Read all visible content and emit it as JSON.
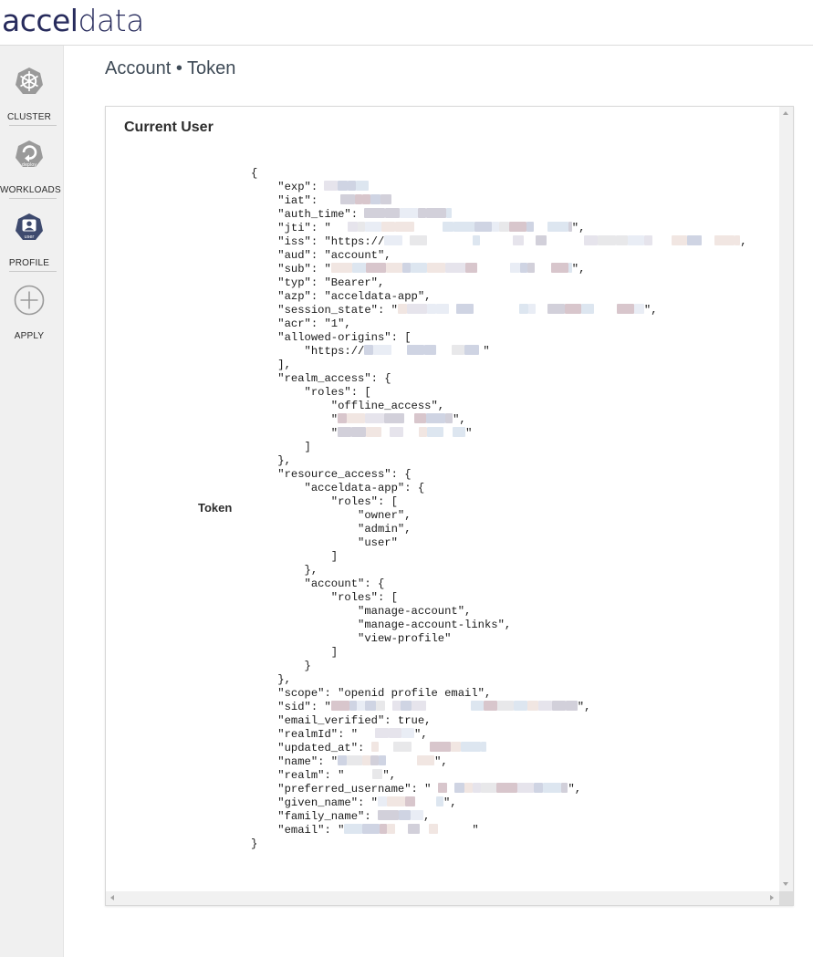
{
  "app": {
    "logo_part1": "accel",
    "logo_part2": "data"
  },
  "sidebar": {
    "items": [
      {
        "label": "CLUSTER",
        "icon": "kubernetes-helm-icon"
      },
      {
        "label": "WORKLOADS",
        "icon": "deploy-icon",
        "badge": "deploy"
      },
      {
        "label": "PROFILE",
        "icon": "user-icon",
        "badge": "user"
      },
      {
        "label": "APPLY",
        "icon": "plus-circle-icon"
      }
    ]
  },
  "page": {
    "title": "Account • Token"
  },
  "panel": {
    "section_title": "Current User",
    "token_label": "Token"
  },
  "token_json": [
    "{",
    "    \"exp\": [[74]]",
    "    \"iat\": [[74]]",
    "    \"auth_time\": [[96]]",
    "    \"jti\": \"[[264]]\",",
    "    \"iss\": \"https://[[390]],",
    "    \"aud\": \"account\",",
    "    \"sub\": \"[[264]]\",",
    "    \"typ\": \"Bearer\",",
    "    \"azp\": \"acceldata-app\",",
    "    \"session_state\": \"[[270]]\",",
    "    \"acr\": \"1\",",
    "    \"allowed-origins\": [",
    "        \"https://[[130]]\"",
    "    ],",
    "    \"realm_access\": {",
    "        \"roles\": [",
    "            \"offline_access\",",
    "            \"[[126]]\",",
    "            \"[[140]]\"",
    "        ]",
    "    },",
    "    \"resource_access\": {",
    "        \"acceldata-app\": {",
    "            \"roles\": [",
    "                \"owner\",",
    "                \"admin\",",
    "                \"user\"",
    "            ]",
    "        },",
    "        \"account\": {",
    "            \"roles\": [",
    "                \"manage-account\",",
    "                \"manage-account-links\",",
    "                \"view-profile\"",
    "            ]",
    "        }",
    "    },",
    "    \"scope\": \"openid profile email\",",
    "    \"sid\": \"[[270]]\",",
    "    \"email_verified\": true,",
    "    \"realmId\": \"[[62]]\",",
    "    \"updated_at\": [[126]]",
    "    \"name\": \"[[106]]\",",
    "    \"realm\": \"[[42]]\",",
    "    \"preferred_username\": \"[[150]]\",",
    "    \"given_name\": \"[[72]]\",",
    "    \"family_name\": [[50]],",
    "    \"email\": \"[[140]]\"",
    "}"
  ],
  "colors": {
    "brand_navy": "#272b5c",
    "profile_icon_bg": "#3e4a6e",
    "sidebar_bg": "#f0f0f0",
    "redaction_palette": [
      "#e6e4ec",
      "#d2d0da",
      "#e9edf5",
      "#f1e6e2",
      "#cfd4e3",
      "#e8e8ea",
      "#dde6f0",
      "#d8c6cc"
    ]
  }
}
